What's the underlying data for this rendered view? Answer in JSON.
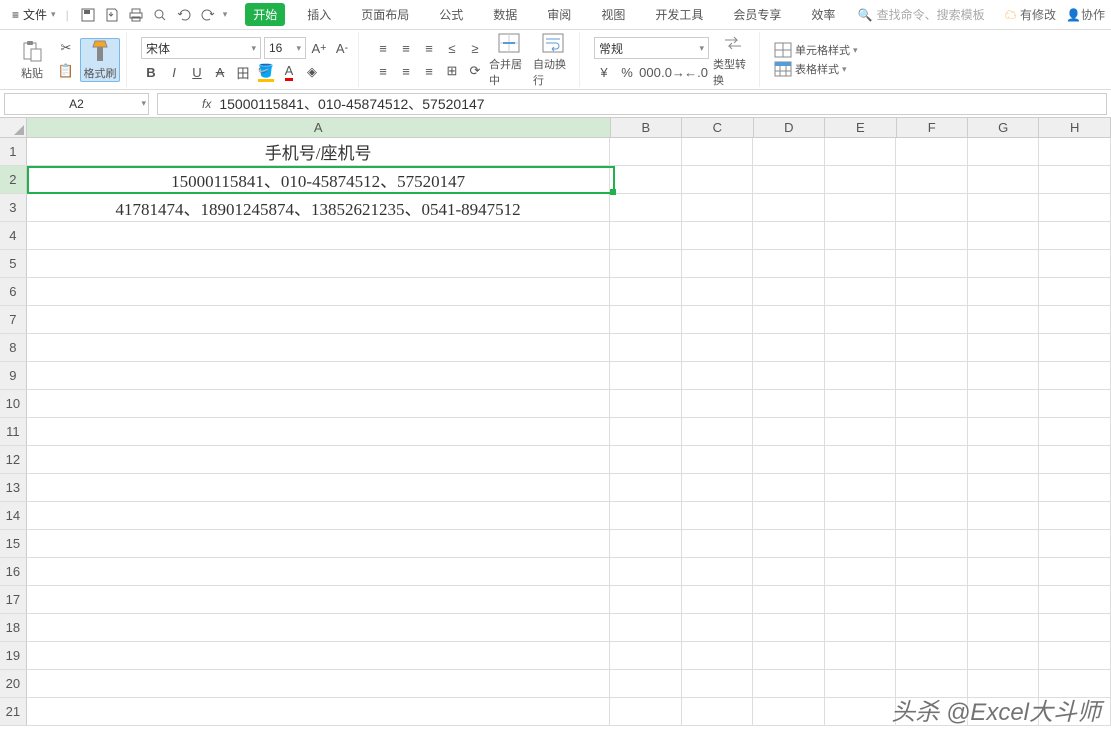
{
  "menubar": {
    "file": "文件",
    "tabs": [
      "开始",
      "插入",
      "页面布局",
      "公式",
      "数据",
      "审阅",
      "视图",
      "开发工具",
      "会员专享",
      "效率"
    ],
    "active_tab": 0,
    "search_placeholder": "查找命令、搜索模板",
    "right_links": {
      "changes": "有修改",
      "collab": "协作"
    }
  },
  "ribbon": {
    "paste": "粘贴",
    "format_painter": "格式刷",
    "font_name": "宋体",
    "font_size": "16",
    "merge_center": "合并居中",
    "wrap_text": "自动换行",
    "number_format": "常规",
    "type_convert": "类型转换",
    "cell_format": "单元格样式",
    "table_style": "表格样式"
  },
  "formula_bar": {
    "cell_ref": "A2",
    "formula": "15000115841、010-45874512、57520147"
  },
  "sheet": {
    "columns": [
      "A",
      "B",
      "C",
      "D",
      "E",
      "F",
      "G",
      "H"
    ],
    "selected_col": "A",
    "selected_row": 2,
    "rows": [
      {
        "n": 1,
        "A": "手机号/座机号"
      },
      {
        "n": 2,
        "A": "15000115841、010-45874512、57520147"
      },
      {
        "n": 3,
        "A": "41781474、18901245874、13852621235、0541-8947512"
      },
      {
        "n": 4,
        "A": ""
      },
      {
        "n": 5,
        "A": ""
      },
      {
        "n": 6,
        "A": ""
      },
      {
        "n": 7,
        "A": ""
      },
      {
        "n": 8,
        "A": ""
      },
      {
        "n": 9,
        "A": ""
      },
      {
        "n": 10,
        "A": ""
      },
      {
        "n": 11,
        "A": ""
      },
      {
        "n": 12,
        "A": ""
      },
      {
        "n": 13,
        "A": ""
      },
      {
        "n": 14,
        "A": ""
      },
      {
        "n": 15,
        "A": ""
      },
      {
        "n": 16,
        "A": ""
      },
      {
        "n": 17,
        "A": ""
      },
      {
        "n": 18,
        "A": ""
      },
      {
        "n": 19,
        "A": ""
      },
      {
        "n": 20,
        "A": ""
      },
      {
        "n": 21,
        "A": ""
      }
    ]
  },
  "watermark": "头杀 @Excel大斗师"
}
